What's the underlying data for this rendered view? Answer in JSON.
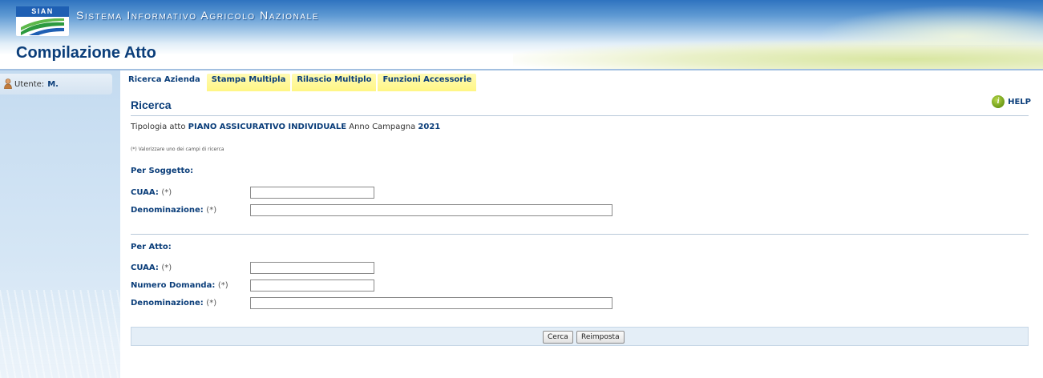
{
  "header": {
    "logo_text": "SIAN",
    "app_title": "Sistema Informativo Agricolo Nazionale",
    "page_title": "Compilazione Atto"
  },
  "sidebar": {
    "user_label": "Utente:",
    "user_value": "M."
  },
  "tabs": [
    {
      "label": "Ricerca Azienda",
      "active": true
    },
    {
      "label": "Stampa Multipla",
      "active": false
    },
    {
      "label": "Rilascio Multiplo",
      "active": false
    },
    {
      "label": "Funzioni Accessorie",
      "active": false
    }
  ],
  "help": {
    "icon": "help-icon",
    "label": "HELP"
  },
  "section": {
    "title": "Ricerca"
  },
  "tipologia": {
    "prefix": "Tipologia atto",
    "tipo": "PIANO ASSICURATIVO INDIVIDUALE",
    "anno_label": "Anno Campagna",
    "anno": "2021"
  },
  "note": "(*) Valorizzare uno dei campi di ricerca",
  "required_marker": "(*)",
  "per_soggetto": {
    "title": "Per Soggetto:",
    "cuaa": {
      "label": "CUAA:",
      "value": ""
    },
    "denominazione": {
      "label": "Denominazione:",
      "value": ""
    }
  },
  "per_atto": {
    "title": "Per Atto:",
    "cuaa": {
      "label": "CUAA:",
      "value": ""
    },
    "numero_domanda": {
      "label": "Numero Domanda:",
      "value": ""
    },
    "denominazione": {
      "label": "Denominazione:",
      "value": ""
    }
  },
  "buttons": {
    "cerca": "Cerca",
    "reimposta": "Reimposta"
  },
  "colors": {
    "brand_blue": "#0b3e7a",
    "tab_yellow": "#fff685",
    "button_bar": "#e4eef7"
  }
}
